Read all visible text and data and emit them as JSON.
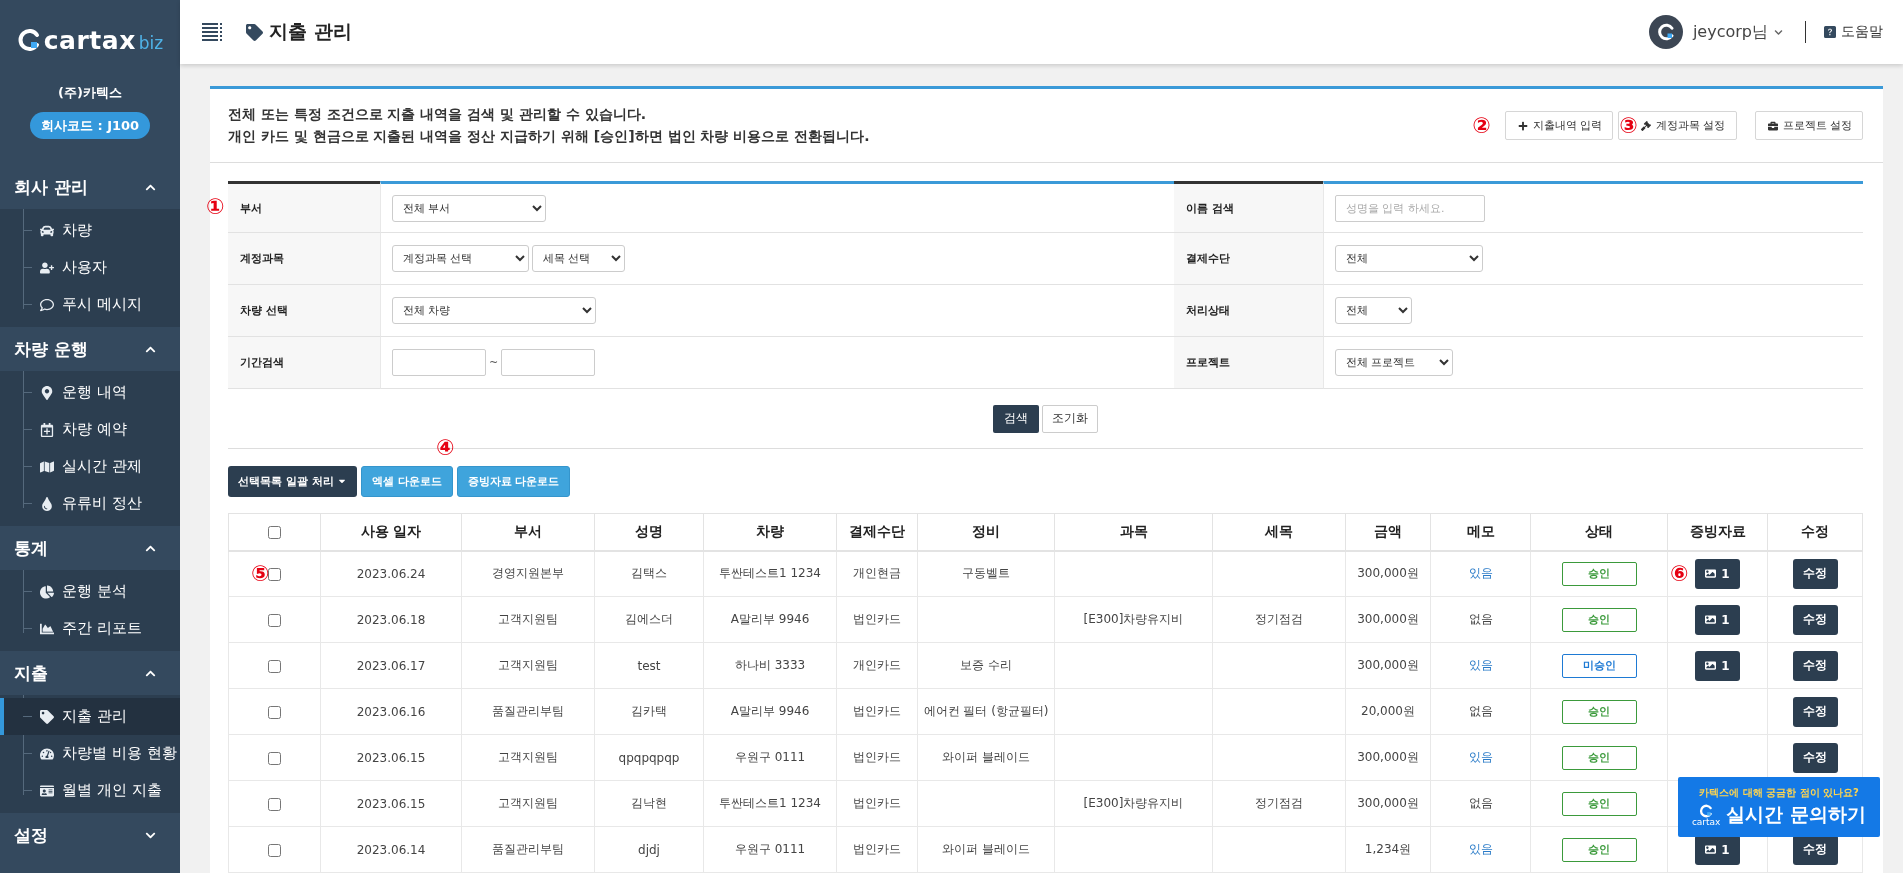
{
  "sidebar": {
    "logo": {
      "name": "cartax",
      "suffix": "biz"
    },
    "company": "(주)카텍스",
    "company_code": "회사코드 : J100",
    "sections": [
      {
        "title": "회사 관리",
        "expanded": true,
        "items": [
          {
            "label": "차량",
            "selected": false
          },
          {
            "label": "사용자",
            "selected": false
          },
          {
            "label": "푸시 메시지",
            "selected": false
          }
        ]
      },
      {
        "title": "차량 운행",
        "expanded": true,
        "items": [
          {
            "label": "운행 내역",
            "selected": false
          },
          {
            "label": "차량 예약",
            "selected": false
          },
          {
            "label": "실시간 관제",
            "selected": false
          },
          {
            "label": "유류비 정산",
            "selected": false
          }
        ]
      },
      {
        "title": "통계",
        "expanded": true,
        "items": [
          {
            "label": "운행 분석",
            "selected": false
          },
          {
            "label": "주간 리포트",
            "selected": false
          }
        ]
      },
      {
        "title": "지출",
        "expanded": true,
        "items": [
          {
            "label": "지출 관리",
            "selected": true
          },
          {
            "label": "차량별 비용 현황",
            "selected": false
          },
          {
            "label": "월별 개인 지출",
            "selected": false
          }
        ]
      },
      {
        "title": "설정",
        "expanded": false
      }
    ]
  },
  "header": {
    "title": "지출 관리",
    "user": "jeycorp님",
    "help": "도움말"
  },
  "description": {
    "lines": [
      "전체 또는 특정 조건으로 지출 내역을 검색 및 관리할 수 있습니다.",
      "개인 카드 및 현금으로 지출된 내역을 정산 지급하기 위해 [승인]하면 법인 차량 비용으로 전환됩니다."
    ],
    "buttons": [
      {
        "label": "지출내역 입력",
        "marker": "②"
      },
      {
        "label": "계정과목 설정",
        "marker": "③"
      },
      {
        "label": "프로젝트 설정"
      }
    ]
  },
  "filters": {
    "marker": "①",
    "rows": [
      {
        "left": {
          "label": "부서",
          "fields": [
            {
              "kind": "select",
              "value": "전체 부서"
            }
          ]
        },
        "right": {
          "label": "이름 검색",
          "fields": [
            {
              "kind": "input",
              "placeholder": "성명을 입력 하세요."
            }
          ]
        }
      },
      {
        "left": {
          "label": "계정과목",
          "fields": [
            {
              "kind": "select",
              "value": "계정과목 선택"
            },
            {
              "kind": "select",
              "value": "세목 선택"
            }
          ]
        },
        "right": {
          "label": "결제수단",
          "fields": [
            {
              "kind": "select",
              "value": "전체"
            }
          ]
        }
      },
      {
        "left": {
          "label": "차량 선택",
          "fields": [
            {
              "kind": "select",
              "value": "전체 차량"
            }
          ]
        },
        "right": {
          "label": "처리상태",
          "fields": [
            {
              "kind": "select",
              "value": "전체"
            }
          ]
        }
      },
      {
        "left": {
          "label": "기간검색",
          "fields": [
            {
              "kind": "input"
            },
            {
              "kind": "separator",
              "text": "~"
            },
            {
              "kind": "input"
            }
          ]
        },
        "right": {
          "label": "프로젝트",
          "fields": [
            {
              "kind": "select",
              "value": "전체 프로젝트"
            }
          ]
        }
      }
    ],
    "search": "검색",
    "reset": "조기화"
  },
  "actions": {
    "marker": "④",
    "bulk": "선택목록 일괄 처리",
    "excel": "엑셀 다운로드",
    "proof_download": "증빙자료 다운로드"
  },
  "table": {
    "select_all": {
      "checked": false
    },
    "columns": [
      "사용 일자",
      "부서",
      "성명",
      "차량",
      "결제수단",
      "정비",
      "과목",
      "세목",
      "금액",
      "메모",
      "상태",
      "증빙자료",
      "수정"
    ],
    "rows": [
      {
        "checked": false,
        "marker": "⑤",
        "date": "2023.06.24",
        "dept": "경영지원본부",
        "name": "김택스",
        "vehicle": "투싼테스트1 1234",
        "payment": "개인현금",
        "maintenance": "구동벨트",
        "amount": "300,000원",
        "memo": {
          "text": "있음",
          "link": true
        },
        "status": {
          "label": "승인",
          "kind": "approved"
        },
        "proof_marker": "⑥",
        "proof": "1",
        "edit": "수정"
      },
      {
        "checked": false,
        "date": "2023.06.18",
        "dept": "고객지원팀",
        "name": "김에스더",
        "vehicle": "A말리부 9946",
        "payment": "법인카드",
        "subject": "[E300]차량유지비",
        "detail": "정기점검",
        "amount": "300,000원",
        "memo": {
          "text": "없음",
          "link": false
        },
        "status": {
          "label": "승인",
          "kind": "approved"
        },
        "proof": "1",
        "edit": "수정"
      },
      {
        "checked": false,
        "date": "2023.06.17",
        "dept": "고객지원팀",
        "name": "test",
        "vehicle": "하나비 3333",
        "payment": "개인카드",
        "maintenance": "보증 수리",
        "amount": "300,000원",
        "memo": {
          "text": "있음",
          "link": true
        },
        "status": {
          "label": "미승인",
          "kind": "pending"
        },
        "proof": "1",
        "edit": "수정"
      },
      {
        "checked": false,
        "date": "2023.06.16",
        "dept": "품질관리부팀",
        "name": "김카택",
        "vehicle": "A말리부 9946",
        "payment": "법인카드",
        "maintenance": "에어컨 필터 (항균필터)",
        "amount": "20,000원",
        "memo": {
          "text": "없음",
          "link": false
        },
        "status": {
          "label": "승인",
          "kind": "approved"
        },
        "edit": "수정"
      },
      {
        "checked": false,
        "date": "2023.06.15",
        "dept": "고객지원팀",
        "name": "qpqpqpqp",
        "vehicle": "우원구 0111",
        "payment": "법인카드",
        "maintenance": "와이퍼 블레이드",
        "amount": "300,000원",
        "memo": {
          "text": "있음",
          "link": true
        },
        "status": {
          "label": "승인",
          "kind": "approved"
        },
        "edit": "수정"
      },
      {
        "checked": false,
        "date": "2023.06.15",
        "dept": "고객지원팀",
        "name": "김낙현",
        "vehicle": "투싼테스트1 1234",
        "payment": "법인카드",
        "subject": "[E300]차량유지비",
        "detail": "정기점검",
        "amount": "300,000원",
        "memo": {
          "text": "없음",
          "link": false
        },
        "status": {
          "label": "승인",
          "kind": "approved"
        }
      },
      {
        "checked": false,
        "date": "2023.06.14",
        "dept": "품질관리부팀",
        "name": "djdj",
        "vehicle": "우원구 0111",
        "payment": "법인카드",
        "maintenance": "와이퍼 블레이드",
        "amount": "1,234원",
        "memo": {
          "text": "있음",
          "link": true
        },
        "status": {
          "label": "승인",
          "kind": "approved"
        },
        "proof": "1",
        "edit": "수정"
      }
    ]
  },
  "chat": {
    "question": "카텍스에 대해 궁금한 점이 있나요?",
    "logo": "cartax",
    "action": "실시간 문의하기"
  }
}
